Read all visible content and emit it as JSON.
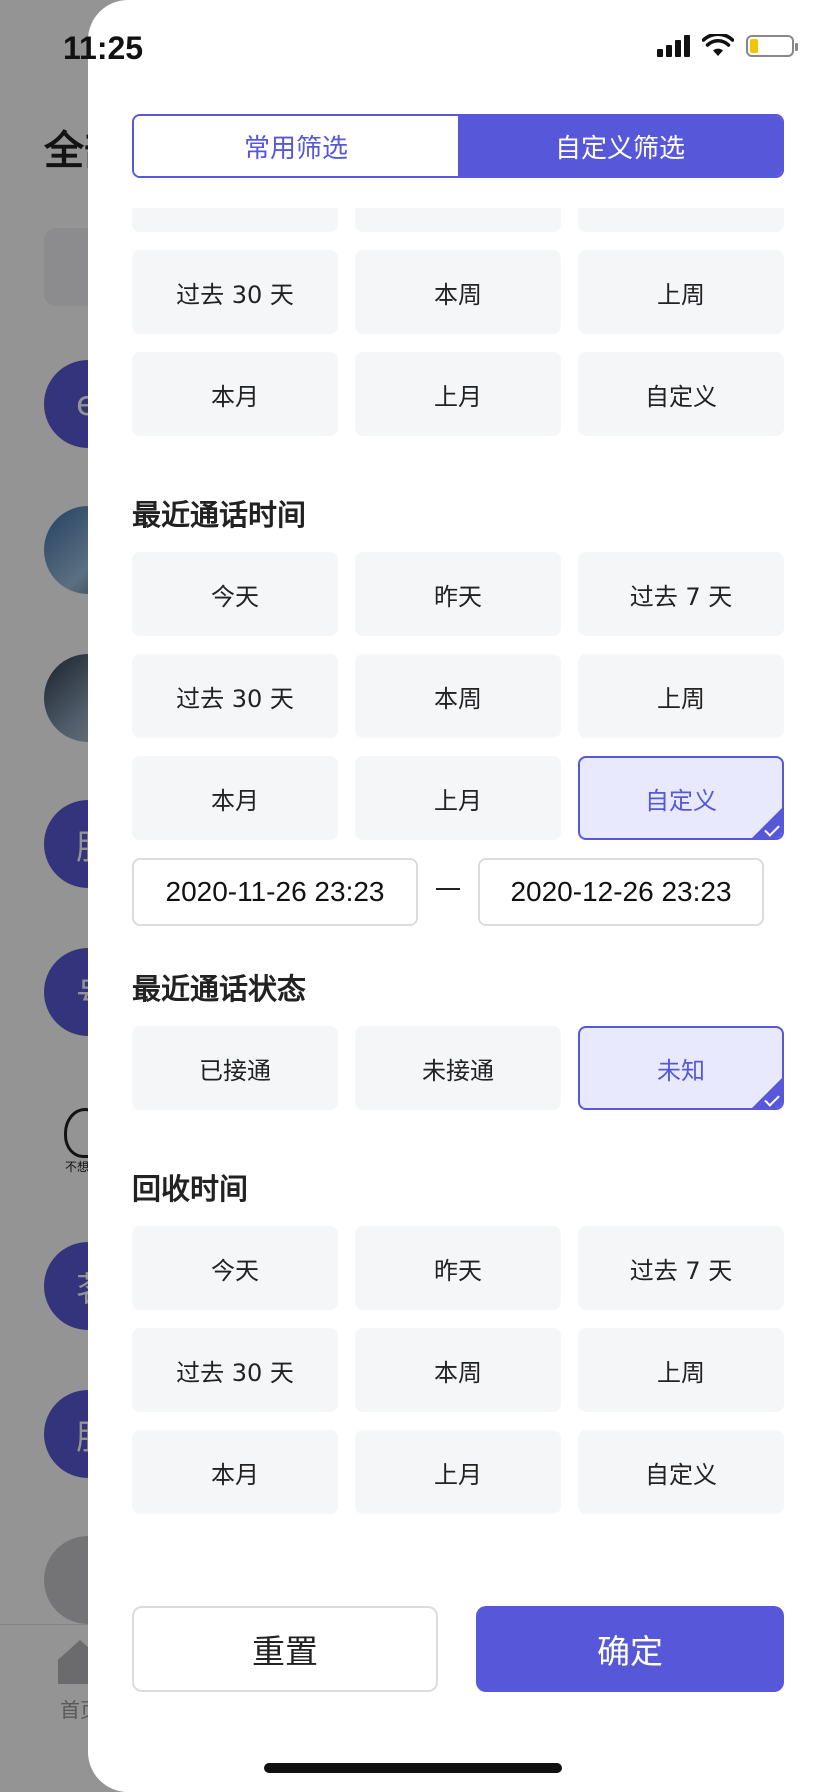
{
  "status_bar": {
    "time": "11:25"
  },
  "background": {
    "title_partial": "全部",
    "avatars": [
      "e",
      "",
      "",
      "肝",
      "号",
      "茗",
      "肝",
      ""
    ],
    "sticker_text": "不想吃",
    "tab_home_label": "首页"
  },
  "tabs": [
    {
      "label": "常用筛选",
      "active": false
    },
    {
      "label": "自定义筛选",
      "active": true
    }
  ],
  "section_top": {
    "rows": [
      [
        "过去 30 天",
        "本周",
        "上周"
      ],
      [
        "本月",
        "上月",
        "自定义"
      ]
    ]
  },
  "section_call_time": {
    "title": "最近通话时间",
    "rows": [
      [
        "今天",
        "昨天",
        "过去 7 天"
      ],
      [
        "过去 30 天",
        "本周",
        "上周"
      ],
      [
        "本月",
        "上月",
        "自定义"
      ]
    ],
    "selected": "自定义",
    "date_start": "2020-11-26 23:23",
    "date_end": "2020-12-26 23:23"
  },
  "section_call_status": {
    "title": "最近通话状态",
    "options": [
      "已接通",
      "未接通",
      "未知"
    ],
    "selected": "未知"
  },
  "section_recycle_time": {
    "title": "回收时间",
    "rows": [
      [
        "今天",
        "昨天",
        "过去 7 天"
      ],
      [
        "过去 30 天",
        "本周",
        "上周"
      ],
      [
        "本月",
        "上月",
        "自定义"
      ]
    ]
  },
  "actions": {
    "reset": "重置",
    "confirm": "确定"
  },
  "colors": {
    "accent": "#5758d9",
    "selected_bg": "#e9e9fd",
    "button_bg": "#f5f6f8"
  }
}
